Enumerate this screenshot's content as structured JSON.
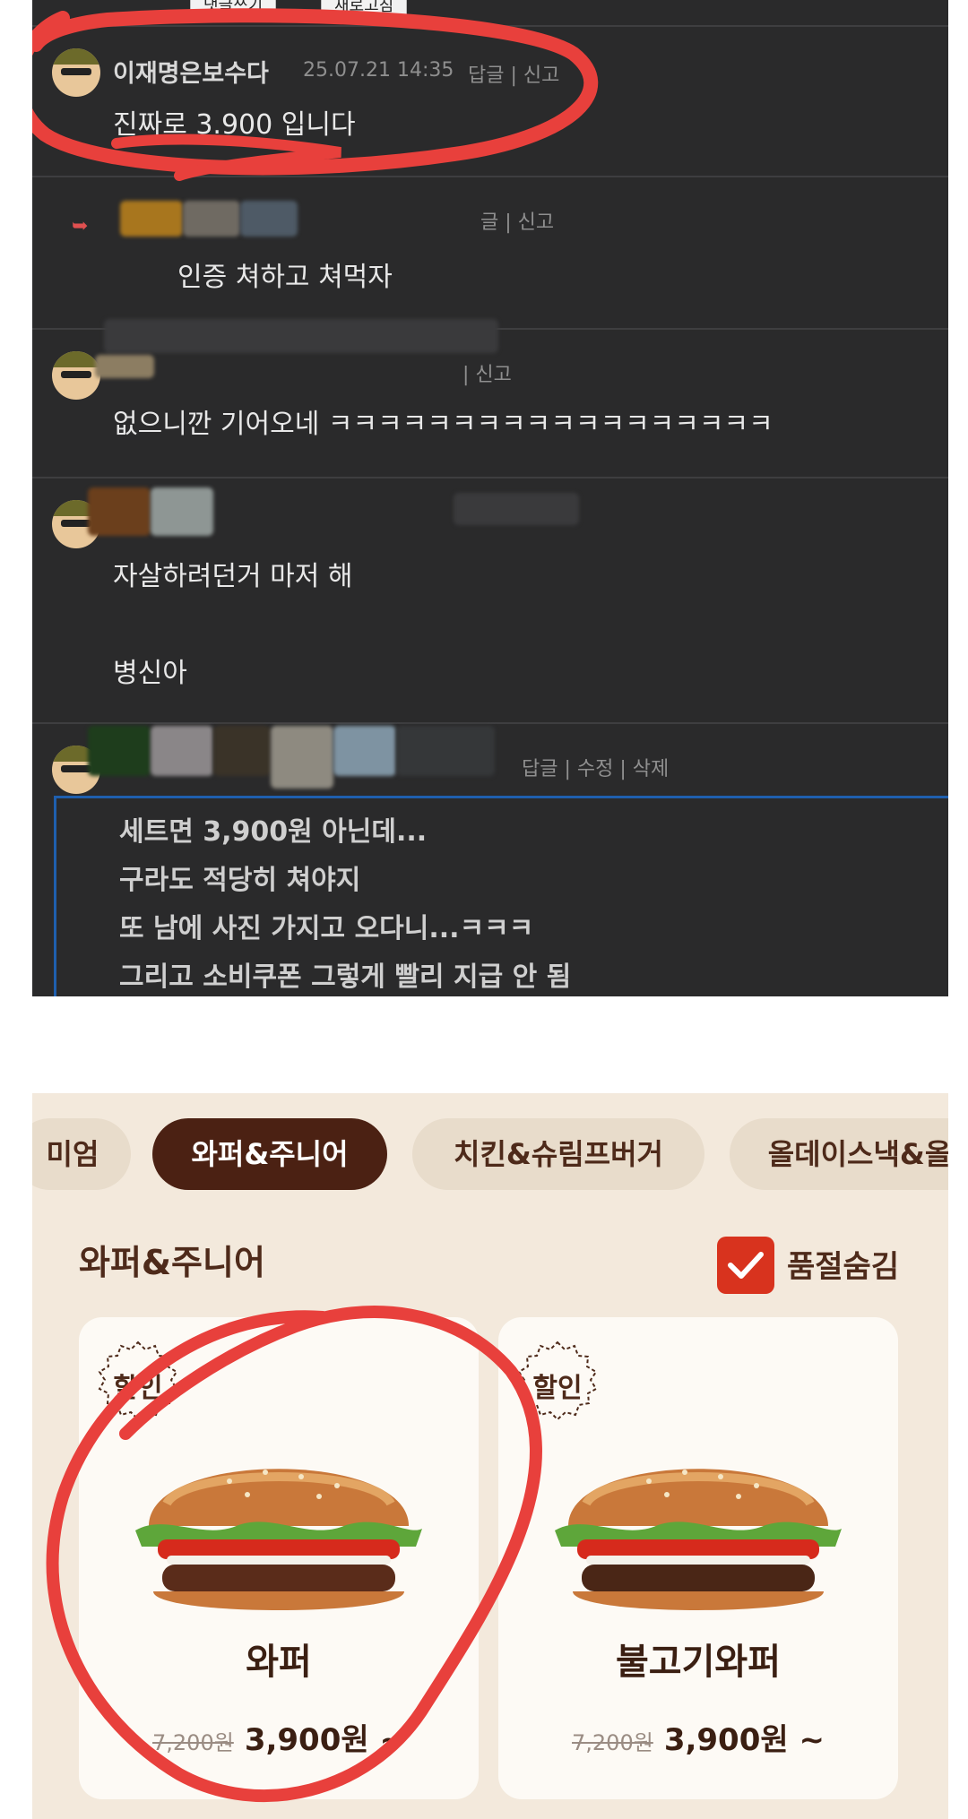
{
  "comments_section": {
    "header_buttons": [
      "댓글쓰기",
      "새로고침"
    ],
    "comments": [
      {
        "nickname": "이재명은보수다",
        "date": "25.07.21 14:35",
        "actions": "답글 | 신고",
        "body": "진짜로 3.900 입니다"
      },
      {
        "actions": "글 | 신고",
        "body": "인증 쳐하고 쳐먹자"
      },
      {
        "actions": "| 신고",
        "body": "없으니깐 기어오네 ㅋㅋㅋㅋㅋㅋㅋㅋㅋㅋㅋㅋㅋㅋㅋㅋㅋㅋ"
      },
      {
        "body_lines": [
          "자살하려던거 마저 해",
          "병신아"
        ]
      },
      {
        "actions": "답글 | 수정 | 삭제",
        "edit_lines": [
          "세트면 3,900원 아닌데...",
          "구라도 적당히 쳐야지",
          "또 남에 사진 가지고 오다니...ㅋㅋㅋ",
          "그리고 소비쿠폰 그렇게 빨리 지급 안 됨"
        ]
      }
    ]
  },
  "menu_section": {
    "tabs": [
      {
        "label": "미엄",
        "active": false
      },
      {
        "label": "와퍼&주니어",
        "active": true
      },
      {
        "label": "치킨&슈림프버거",
        "active": false
      },
      {
        "label": "올데이스낵&올",
        "active": false
      }
    ],
    "section_title": "와퍼&주니어",
    "hide_soldout": {
      "label": "품절숨김",
      "checked": true
    },
    "products": [
      {
        "badge": "할인",
        "name": "와퍼",
        "old_price": "7,200원",
        "price": "3,900원 ~"
      },
      {
        "badge": "할인",
        "name": "불고기와퍼",
        "old_price": "7,200원",
        "price": "3,900원 ~"
      }
    ]
  },
  "colors": {
    "accent_brown": "#4b2113",
    "check_red": "#d8331e",
    "annotation_red": "#e8403c",
    "edit_border_blue": "#1f5fae"
  }
}
